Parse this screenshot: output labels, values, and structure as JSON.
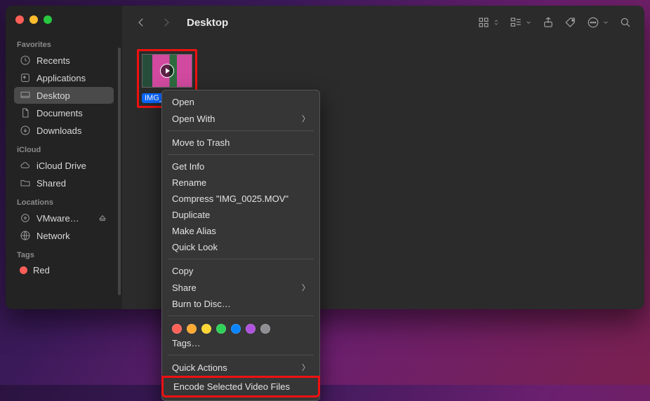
{
  "window": {
    "title": "Desktop"
  },
  "sidebar": {
    "sections": {
      "favorites": {
        "label": "Favorites",
        "items": [
          {
            "label": "Recents"
          },
          {
            "label": "Applications"
          },
          {
            "label": "Desktop"
          },
          {
            "label": "Documents"
          },
          {
            "label": "Downloads"
          }
        ]
      },
      "icloud": {
        "label": "iCloud",
        "items": [
          {
            "label": "iCloud Drive"
          },
          {
            "label": "Shared"
          }
        ]
      },
      "locations": {
        "label": "Locations",
        "items": [
          {
            "label": "VMware…"
          },
          {
            "label": "Network"
          }
        ]
      },
      "tags": {
        "label": "Tags",
        "items": [
          {
            "label": "Red",
            "color": "#ff5f57"
          }
        ]
      }
    }
  },
  "file": {
    "name": "IMG_0025.MOV",
    "name_truncated": "IMG_0…"
  },
  "context_menu": {
    "open": "Open",
    "open_with": "Open With",
    "trash": "Move to Trash",
    "get_info": "Get Info",
    "rename": "Rename",
    "compress": "Compress \"IMG_0025.MOV\"",
    "duplicate": "Duplicate",
    "make_alias": "Make Alias",
    "quick_look": "Quick Look",
    "copy": "Copy",
    "share": "Share",
    "burn": "Burn to Disc…",
    "tags_label": "Tags…",
    "quick_actions": "Quick Actions",
    "encode": "Encode Selected Video Files",
    "tag_colors": [
      "#ff6159",
      "#ffaa33",
      "#ffd633",
      "#30d158",
      "#0a84ff",
      "#af52de",
      "#8e8e93"
    ]
  }
}
